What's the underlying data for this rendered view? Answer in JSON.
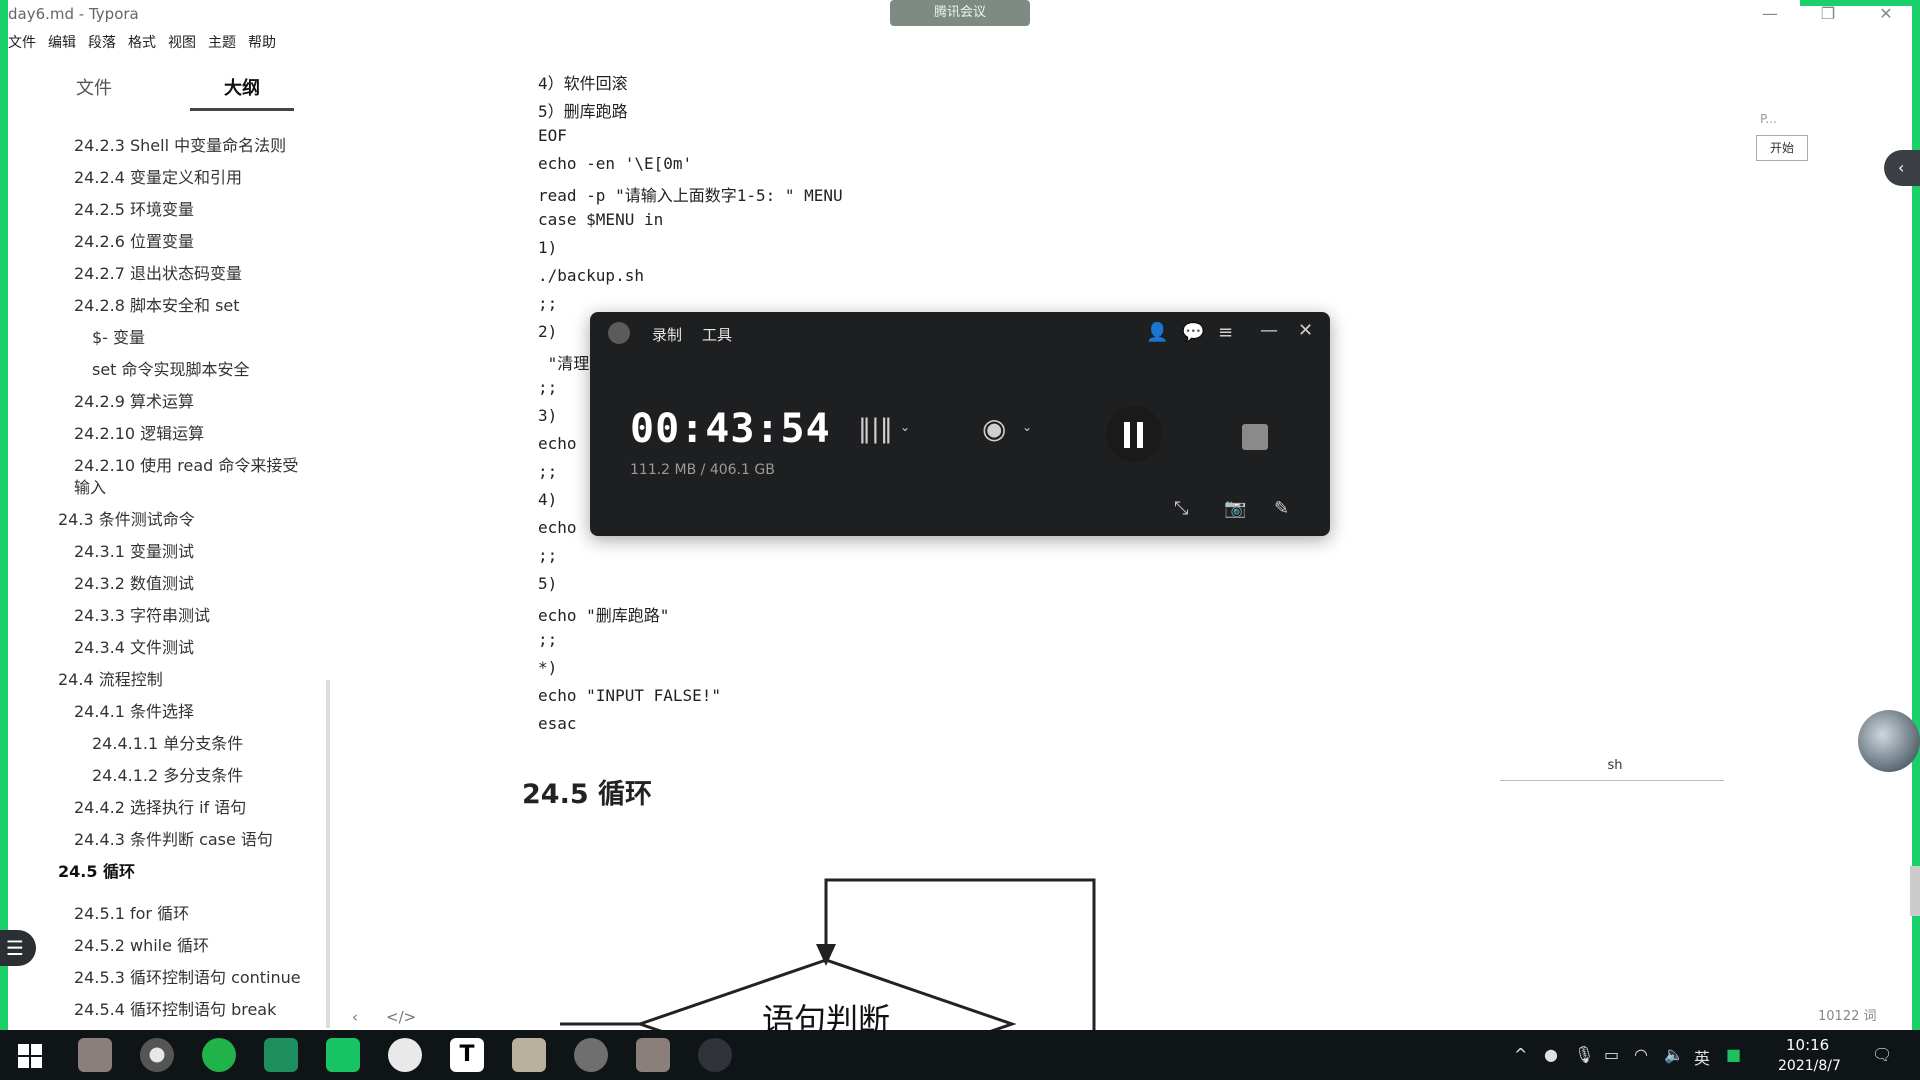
{
  "window": {
    "title": "day6.md - Typora",
    "meeting_badge": "腾讯会议"
  },
  "menu": [
    "文件",
    "编辑",
    "段落",
    "格式",
    "视图",
    "主题",
    "帮助"
  ],
  "sidebar": {
    "tabs": [
      {
        "label": "文件",
        "active": false
      },
      {
        "label": "大纲",
        "active": true
      }
    ],
    "toc": [
      {
        "text": "24.2.3 Shell 中变量命名法则",
        "level": 2
      },
      {
        "text": "24.2.4 变量定义和引用",
        "level": 2
      },
      {
        "text": "24.2.5 环境变量",
        "level": 2
      },
      {
        "text": "24.2.6 位置变量",
        "level": 2
      },
      {
        "text": "24.2.7 退出状态码变量",
        "level": 2
      },
      {
        "text": "24.2.8 脚本安全和 set",
        "level": 2
      },
      {
        "text": "$- 变量",
        "level": 3
      },
      {
        "text": "set 命令实现脚本安全",
        "level": 3
      },
      {
        "text": "24.2.9 算术运算",
        "level": 2
      },
      {
        "text": "24.2.10 逻辑运算",
        "level": 2
      },
      {
        "text": "24.2.10 使用 read 命令来接受",
        "level": 2
      },
      {
        "text": "输入",
        "level": 2
      },
      {
        "text": "24.3 条件测试命令",
        "level": 1
      },
      {
        "text": "24.3.1 变量测试",
        "level": 2
      },
      {
        "text": "24.3.2 数值测试",
        "level": 2
      },
      {
        "text": "24.3.3 字符串测试",
        "level": 2
      },
      {
        "text": "24.3.4 文件测试",
        "level": 2
      },
      {
        "text": "24.4 流程控制",
        "level": 1
      },
      {
        "text": "24.4.1 条件选择",
        "level": 2
      },
      {
        "text": "24.4.1.1 单分支条件",
        "level": 3
      },
      {
        "text": "24.4.1.2 多分支条件",
        "level": 3
      },
      {
        "text": "24.4.2 选择执行 if 语句",
        "level": 2
      },
      {
        "text": "24.4.3 条件判断 case 语句",
        "level": 2
      },
      {
        "text": "24.5 循环",
        "level": 1,
        "bold": true
      },
      {
        "text": "24.5.1 for 循环",
        "level": 2
      },
      {
        "text": "24.5.2 while 循环",
        "level": 2
      },
      {
        "text": "24.5.3 循环控制语句 continue",
        "level": 2
      },
      {
        "text": "24.5.4 循环控制语句 break",
        "level": 2
      }
    ]
  },
  "editor": {
    "code_lines": [
      "4）软件回滚",
      "5）删库跑路",
      "EOF",
      "echo -en '\\E[0m'",
      "read -p \"请输入上面数字1-5: \" MENU",
      "case $MENU in",
      "1)",
      "./backup.sh",
      ";;",
      "2)",
      " \"清理",
      ";;",
      "3)",
      "echo",
      ";;",
      "4)",
      "echo",
      ";;",
      "5)",
      "echo \"删库跑路\"",
      ";;",
      "*)",
      "echo \"INPUT FALSE!\"",
      "esac"
    ],
    "heading": "24.5 循环",
    "flowchart_label": "语句判断",
    "code_lang": "sh",
    "word_count": "10122 词"
  },
  "right_panel": {
    "p_label": "P...",
    "start_button": "开始"
  },
  "recorder": {
    "menu_record": "录制",
    "menu_tools": "工具",
    "timer": "00:43:54",
    "size": "111.2 MB / 406.1 GB",
    "icons": [
      "microphone-icon",
      "webcam-icon",
      "pause-icon",
      "stop-icon",
      "shrink-icon",
      "camera-icon",
      "pen-icon"
    ]
  },
  "taskbar": {
    "apps": [
      "start-icon",
      "photo-app-icon",
      "chrome-icon",
      "wechat-icon",
      "app-icon",
      "meeting-icon",
      "recorder-icon",
      "typora-icon",
      "explorer-icon",
      "xshell-icon",
      "photo-app-2-icon",
      "obs-icon"
    ],
    "ime": "英",
    "time": "10:16",
    "date": "2021/8/7"
  },
  "colors": {
    "frame_green": "#19d06a",
    "recorder_bg": "#1e1f21",
    "taskbar_bg": "#0f1417"
  }
}
